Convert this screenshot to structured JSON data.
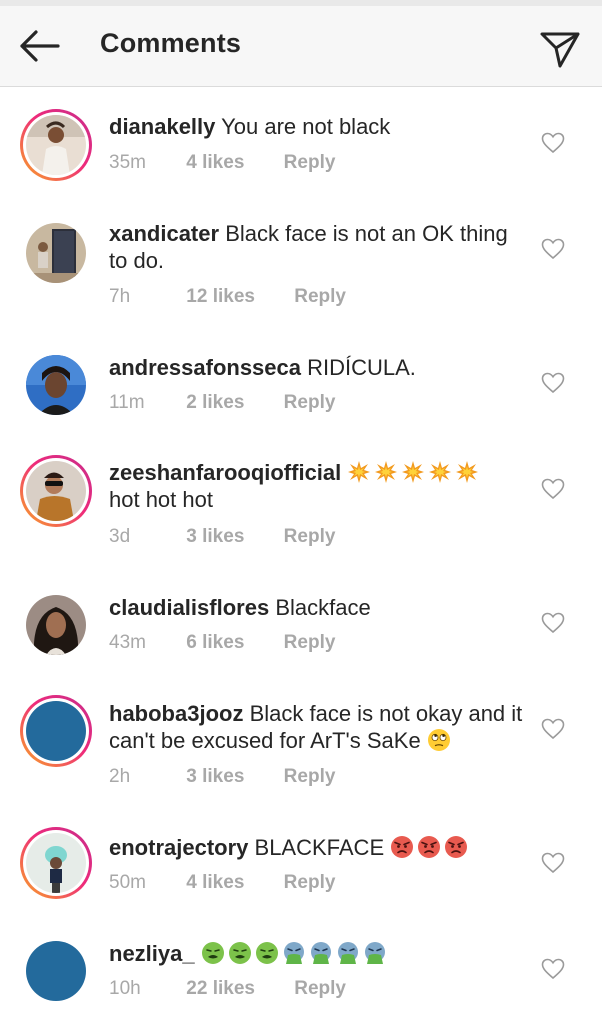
{
  "header": {
    "title": "Comments",
    "back_icon": "arrow-left-icon",
    "share_icon": "paper-plane-icon"
  },
  "colors": {
    "text": "#262626",
    "muted": "#a8a8a8",
    "story_ring_start": "#f9a825",
    "story_ring_end": "#c62d8c",
    "placeholder_avatar": "#236a9c"
  },
  "comments": [
    {
      "username": "dianakelly",
      "text": "You are not black",
      "time": "35m",
      "likes": "4 likes",
      "reply": "Reply",
      "story_ring": true,
      "heart_icon": "heart-outline-icon"
    },
    {
      "username": "xandicater",
      "text": "Black face is not an OK thing to do.",
      "time": "7h",
      "likes": "12 likes",
      "reply": "Reply",
      "story_ring": false,
      "heart_icon": "heart-outline-icon"
    },
    {
      "username": "andressafonsseca",
      "text": "RIDÍCULA.",
      "time": "11m",
      "likes": "2 likes",
      "reply": "Reply",
      "story_ring": false,
      "heart_icon": "heart-outline-icon"
    },
    {
      "username": "zeeshanfarooqiofficial",
      "text": "hot hot hot",
      "emojis": [
        "collision-emoji",
        "collision-emoji",
        "collision-emoji",
        "collision-emoji",
        "collision-emoji"
      ],
      "time": "3d",
      "likes": "3 likes",
      "reply": "Reply",
      "story_ring": true,
      "heart_icon": "heart-outline-icon"
    },
    {
      "username": "claudialisflores",
      "text": "Blackface",
      "time": "43m",
      "likes": "6 likes",
      "reply": "Reply",
      "story_ring": false,
      "heart_icon": "heart-outline-icon"
    },
    {
      "username": "haboba3jooz",
      "text": "Black face is not okay and it can't be excused for ArT's SaKe",
      "emojis": [
        "face-with-rolling-eyes-emoji"
      ],
      "time": "2h",
      "likes": "3 likes",
      "reply": "Reply",
      "story_ring": true,
      "heart_icon": "heart-outline-icon"
    },
    {
      "username": "enotrajectory",
      "text": "BLACKFACE",
      "emojis": [
        "angry-face-emoji",
        "angry-face-emoji",
        "angry-face-emoji"
      ],
      "time": "50m",
      "likes": "4 likes",
      "reply": "Reply",
      "story_ring": true,
      "heart_icon": "heart-outline-icon"
    },
    {
      "username": "nezliya_",
      "text": "",
      "emojis": [
        "nauseated-face-emoji",
        "nauseated-face-emoji",
        "nauseated-face-emoji",
        "vomiting-face-emoji",
        "vomiting-face-emoji",
        "vomiting-face-emoji",
        "vomiting-face-emoji"
      ],
      "time": "10h",
      "likes": "22 likes",
      "reply": "Reply",
      "story_ring": false,
      "heart_icon": "heart-outline-icon"
    }
  ]
}
